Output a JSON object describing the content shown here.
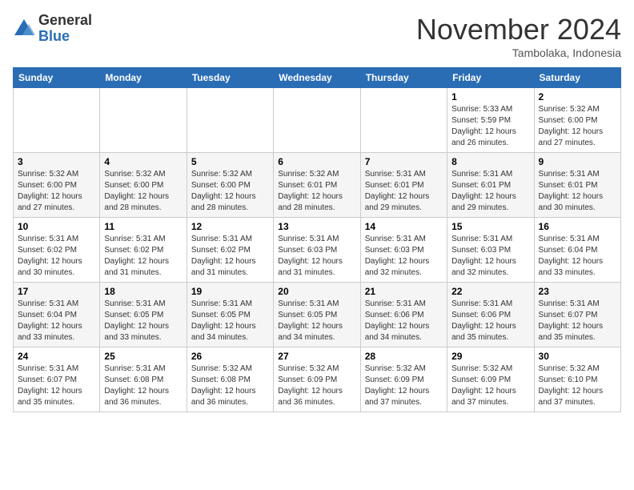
{
  "header": {
    "logo_general": "General",
    "logo_blue": "Blue",
    "month_title": "November 2024",
    "location": "Tambolaka, Indonesia"
  },
  "weekdays": [
    "Sunday",
    "Monday",
    "Tuesday",
    "Wednesday",
    "Thursday",
    "Friday",
    "Saturday"
  ],
  "rows": [
    [
      {
        "day": "",
        "info": ""
      },
      {
        "day": "",
        "info": ""
      },
      {
        "day": "",
        "info": ""
      },
      {
        "day": "",
        "info": ""
      },
      {
        "day": "",
        "info": ""
      },
      {
        "day": "1",
        "info": "Sunrise: 5:33 AM\nSunset: 5:59 PM\nDaylight: 12 hours\nand 26 minutes."
      },
      {
        "day": "2",
        "info": "Sunrise: 5:32 AM\nSunset: 6:00 PM\nDaylight: 12 hours\nand 27 minutes."
      }
    ],
    [
      {
        "day": "3",
        "info": "Sunrise: 5:32 AM\nSunset: 6:00 PM\nDaylight: 12 hours\nand 27 minutes."
      },
      {
        "day": "4",
        "info": "Sunrise: 5:32 AM\nSunset: 6:00 PM\nDaylight: 12 hours\nand 28 minutes."
      },
      {
        "day": "5",
        "info": "Sunrise: 5:32 AM\nSunset: 6:00 PM\nDaylight: 12 hours\nand 28 minutes."
      },
      {
        "day": "6",
        "info": "Sunrise: 5:32 AM\nSunset: 6:01 PM\nDaylight: 12 hours\nand 28 minutes."
      },
      {
        "day": "7",
        "info": "Sunrise: 5:31 AM\nSunset: 6:01 PM\nDaylight: 12 hours\nand 29 minutes."
      },
      {
        "day": "8",
        "info": "Sunrise: 5:31 AM\nSunset: 6:01 PM\nDaylight: 12 hours\nand 29 minutes."
      },
      {
        "day": "9",
        "info": "Sunrise: 5:31 AM\nSunset: 6:01 PM\nDaylight: 12 hours\nand 30 minutes."
      }
    ],
    [
      {
        "day": "10",
        "info": "Sunrise: 5:31 AM\nSunset: 6:02 PM\nDaylight: 12 hours\nand 30 minutes."
      },
      {
        "day": "11",
        "info": "Sunrise: 5:31 AM\nSunset: 6:02 PM\nDaylight: 12 hours\nand 31 minutes."
      },
      {
        "day": "12",
        "info": "Sunrise: 5:31 AM\nSunset: 6:02 PM\nDaylight: 12 hours\nand 31 minutes."
      },
      {
        "day": "13",
        "info": "Sunrise: 5:31 AM\nSunset: 6:03 PM\nDaylight: 12 hours\nand 31 minutes."
      },
      {
        "day": "14",
        "info": "Sunrise: 5:31 AM\nSunset: 6:03 PM\nDaylight: 12 hours\nand 32 minutes."
      },
      {
        "day": "15",
        "info": "Sunrise: 5:31 AM\nSunset: 6:03 PM\nDaylight: 12 hours\nand 32 minutes."
      },
      {
        "day": "16",
        "info": "Sunrise: 5:31 AM\nSunset: 6:04 PM\nDaylight: 12 hours\nand 33 minutes."
      }
    ],
    [
      {
        "day": "17",
        "info": "Sunrise: 5:31 AM\nSunset: 6:04 PM\nDaylight: 12 hours\nand 33 minutes."
      },
      {
        "day": "18",
        "info": "Sunrise: 5:31 AM\nSunset: 6:05 PM\nDaylight: 12 hours\nand 33 minutes."
      },
      {
        "day": "19",
        "info": "Sunrise: 5:31 AM\nSunset: 6:05 PM\nDaylight: 12 hours\nand 34 minutes."
      },
      {
        "day": "20",
        "info": "Sunrise: 5:31 AM\nSunset: 6:05 PM\nDaylight: 12 hours\nand 34 minutes."
      },
      {
        "day": "21",
        "info": "Sunrise: 5:31 AM\nSunset: 6:06 PM\nDaylight: 12 hours\nand 34 minutes."
      },
      {
        "day": "22",
        "info": "Sunrise: 5:31 AM\nSunset: 6:06 PM\nDaylight: 12 hours\nand 35 minutes."
      },
      {
        "day": "23",
        "info": "Sunrise: 5:31 AM\nSunset: 6:07 PM\nDaylight: 12 hours\nand 35 minutes."
      }
    ],
    [
      {
        "day": "24",
        "info": "Sunrise: 5:31 AM\nSunset: 6:07 PM\nDaylight: 12 hours\nand 35 minutes."
      },
      {
        "day": "25",
        "info": "Sunrise: 5:31 AM\nSunset: 6:08 PM\nDaylight: 12 hours\nand 36 minutes."
      },
      {
        "day": "26",
        "info": "Sunrise: 5:32 AM\nSunset: 6:08 PM\nDaylight: 12 hours\nand 36 minutes."
      },
      {
        "day": "27",
        "info": "Sunrise: 5:32 AM\nSunset: 6:09 PM\nDaylight: 12 hours\nand 36 minutes."
      },
      {
        "day": "28",
        "info": "Sunrise: 5:32 AM\nSunset: 6:09 PM\nDaylight: 12 hours\nand 37 minutes."
      },
      {
        "day": "29",
        "info": "Sunrise: 5:32 AM\nSunset: 6:09 PM\nDaylight: 12 hours\nand 37 minutes."
      },
      {
        "day": "30",
        "info": "Sunrise: 5:32 AM\nSunset: 6:10 PM\nDaylight: 12 hours\nand 37 minutes."
      }
    ]
  ]
}
